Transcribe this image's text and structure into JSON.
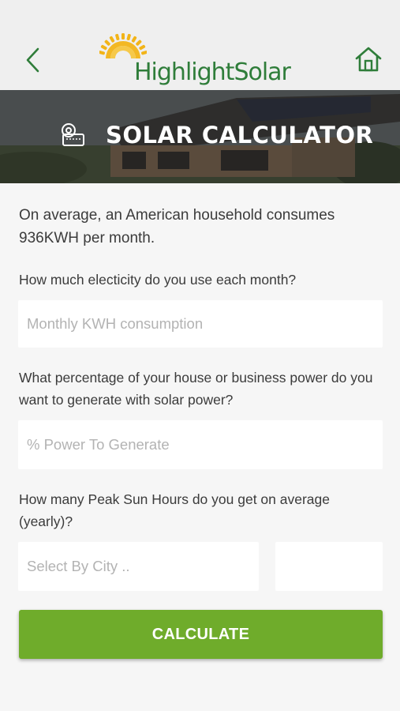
{
  "header": {
    "brand_name": "HighlightSolar",
    "back_icon": "chevron-left-icon",
    "home_icon": "home-icon",
    "brand_color": "#2f7d3a",
    "sun_color": "#f2b418"
  },
  "hero": {
    "title": "SOLAR CALCULATOR",
    "icon": "calculator-roll-icon"
  },
  "main": {
    "intro_text": "On average, an American household consumes 936KWH per month.",
    "q1": "How much electicity do you use each month?",
    "q1_placeholder": "Monthly KWH consumption",
    "q2": "What percentage of your house or business power do you want to generate with solar power?",
    "q2_placeholder": "% Power To Generate",
    "q3": "How many Peak Sun Hours do you get on average (yearly)?",
    "q3_placeholder": "Select By City ..",
    "q3_value": "",
    "calculate_label": "CALCULATE",
    "accent_color": "#6fac2b"
  }
}
